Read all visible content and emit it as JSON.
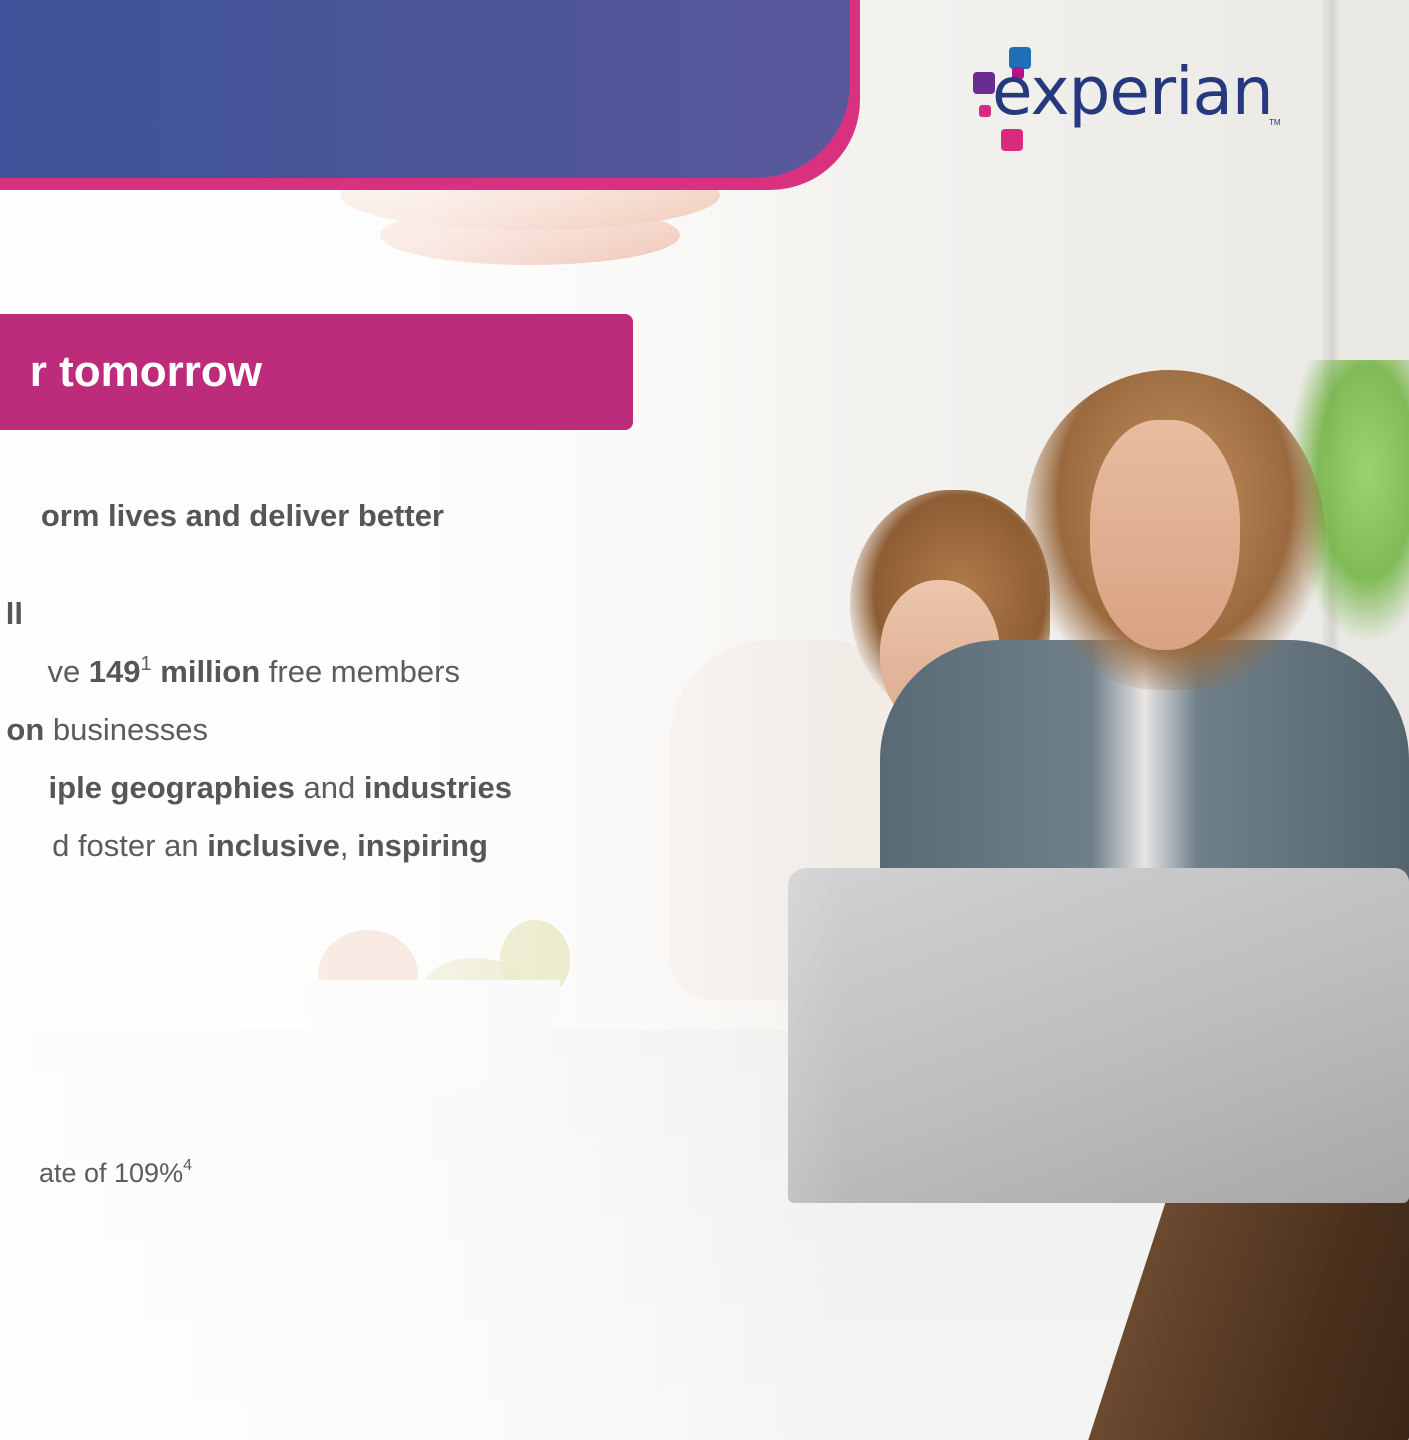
{
  "slide": {
    "heading": "r tomorrow",
    "lines": [
      {
        "segments": [
          {
            "text": "orm lives and deliver better",
            "bold": true
          }
        ]
      },
      {
        "segments": [
          {
            "text": "ll",
            "bold": true
          }
        ]
      },
      {
        "segments": [
          {
            "text": "ve ",
            "bold": false
          },
          {
            "text": "149",
            "bold": true
          },
          {
            "text": "1",
            "bold": true,
            "sup": true
          },
          {
            "text": " million",
            "bold": true
          },
          {
            "text": " free members",
            "bold": false
          }
        ]
      },
      {
        "segments": [
          {
            "text": "on",
            "bold": true
          },
          {
            "text": " businesses",
            "bold": false
          }
        ]
      },
      {
        "segments": [
          {
            "text": "iple geographies",
            "bold": true
          },
          {
            "text": " and ",
            "bold": false
          },
          {
            "text": "industries",
            "bold": true
          }
        ]
      },
      {
        "segments": [
          {
            "text": "d foster an ",
            "bold": false
          },
          {
            "text": "inclusive",
            "bold": true
          },
          {
            "text": ", ",
            "bold": false
          },
          {
            "text": "inspiring",
            "bold": true
          }
        ]
      },
      {
        "segments": [
          {
            "text": "ate of 109%",
            "bold": false
          },
          {
            "text": "4",
            "bold": false,
            "sup": true
          }
        ]
      }
    ]
  },
  "logo": {
    "name": "experian",
    "wordmark": "experian",
    "trademark": "TM"
  },
  "colors": {
    "banner": "#4a5596",
    "banner_edge": "#d8327f",
    "heading_bar": "#bd2c7a",
    "logo_text": "#27397e",
    "body_text": "#5c5c5c"
  }
}
